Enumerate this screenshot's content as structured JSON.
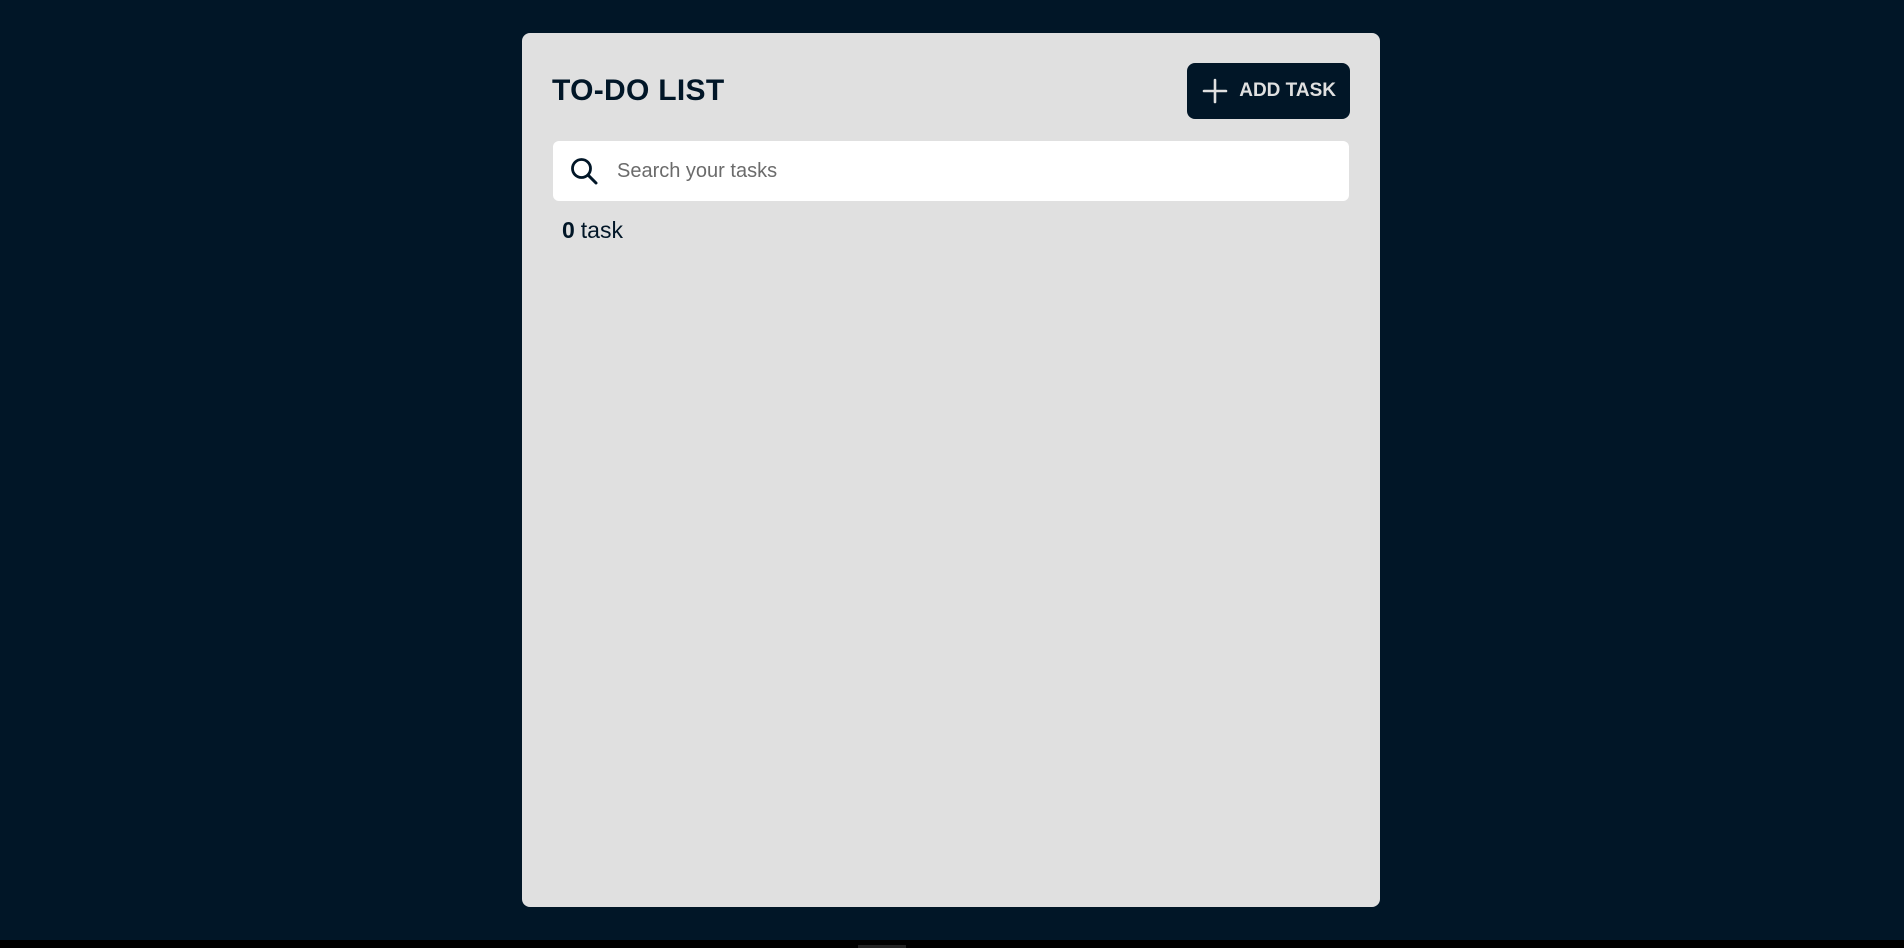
{
  "app": {
    "title": "TO-DO LIST"
  },
  "toolbar": {
    "add_label": "ADD TASK",
    "add_icon": "plus-icon"
  },
  "search": {
    "placeholder": "Search your tasks",
    "value": "",
    "icon": "search-icon"
  },
  "summary": {
    "count": "0",
    "unit": "task"
  },
  "colors": {
    "background": "#011627",
    "card": "#e0e0e0",
    "accent": "#011627",
    "input_bg": "#ffffff"
  }
}
